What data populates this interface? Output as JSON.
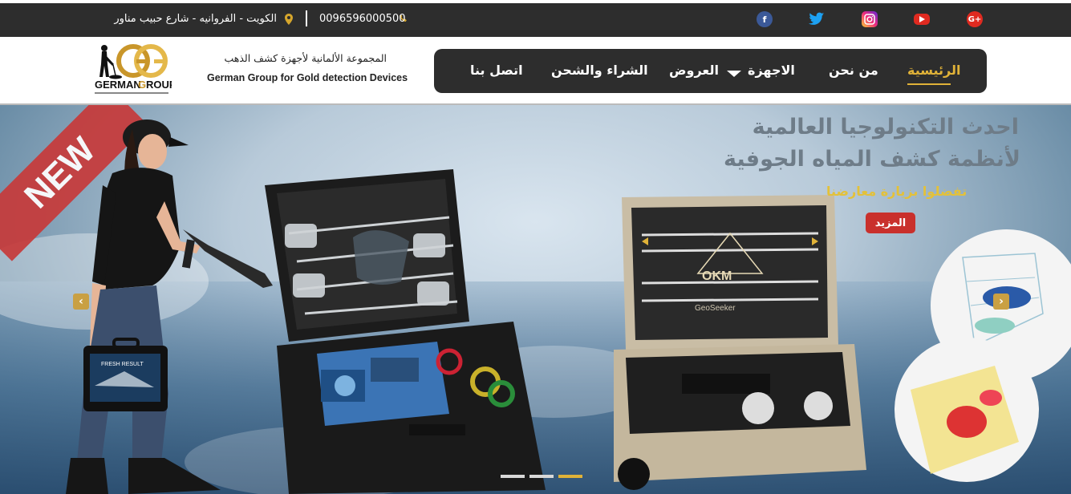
{
  "topbar": {
    "address": "الكويت - الفروانيه - شارع حبيب مناور",
    "phone": "0096596000500",
    "social": [
      {
        "name": "facebook",
        "glyph": "f",
        "color": "#3b5998"
      },
      {
        "name": "twitter",
        "glyph": "t",
        "color": "#1da1f2"
      },
      {
        "name": "instagram",
        "glyph": "◎",
        "color": "#d62976"
      },
      {
        "name": "youtube",
        "glyph": "▶",
        "color": "#e02a20"
      },
      {
        "name": "google-plus",
        "glyph": "G+",
        "color": "#dd4b39"
      }
    ]
  },
  "header": {
    "brand_ar": "المجموعة الألمانية لأجهزة كشف الذهب",
    "brand_en": "German Group for Gold detection Devices",
    "logo_text": "GERMAN GROUP"
  },
  "nav": {
    "items": [
      {
        "label": "الرئيسية",
        "active": true
      },
      {
        "label": "من نحن"
      },
      {
        "label": "الاجهزة"
      },
      {
        "label": "العروض"
      },
      {
        "label": "الشراء والشحن"
      },
      {
        "label": "اتصل بنا"
      }
    ]
  },
  "slider": {
    "badge": "NEW",
    "headline_line1": "احدث التكنولوجيا العالمية",
    "headline_line2": "لأنظمة كشف المياه الجوفية",
    "subline": "تفضلوا بزيارة معارضنا",
    "more_button": "المزيد",
    "prev_glyph": "‹",
    "next_glyph": "›",
    "slide_count": 3,
    "active_slide": 3,
    "device1_label": "FRESH RESULT",
    "device2_label": "OKM",
    "device2_sublabel": "GeoSeeker"
  },
  "colors": {
    "accent": "#e0b238",
    "dark": "#2d2d2d",
    "red": "#c9302c"
  }
}
